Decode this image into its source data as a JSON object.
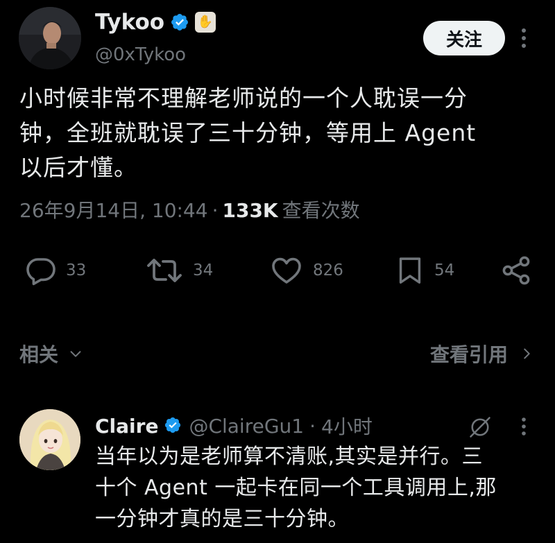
{
  "tweet": {
    "author": {
      "name": "Tykoo",
      "handle": "@0xTykoo",
      "affiliate_badge_glyph": "✋"
    },
    "follow_label": "关注",
    "text": "小时候非常不理解老师说的一个人耽误一分\n钟，全班就耽误了三十分钟，等用上 Agent\n以后才懂。",
    "timestamp": "26年9月14日, 10:44",
    "separator": "·",
    "views_count": "133K",
    "views_label": "查看次数",
    "stats": {
      "replies": "33",
      "retweets": "34",
      "likes": "826",
      "bookmarks": "54"
    }
  },
  "related": {
    "label": "相关",
    "quotes_label": "查看引用"
  },
  "reply": {
    "name": "Claire",
    "handle": "@ClaireGu1",
    "separator": "·",
    "time": "4小时",
    "text": "当年以为是老师算不清账,其实是并行。三\n十个 Agent 一起卡在同一个工具调用上,那\n一分钟才真的是三十分钟。"
  },
  "colors": {
    "background": "#000000",
    "text_primary": "#e7e9ea",
    "text_secondary": "#71767b",
    "verified_blue": "#1d9bf0",
    "follow_button_bg": "#eff3f4"
  },
  "icons": {
    "verified": "verified-badge-icon",
    "more": "more-vertical-icon",
    "reply": "reply-icon",
    "retweet": "retweet-icon",
    "like": "heart-icon",
    "bookmark": "bookmark-icon",
    "share": "share-icon",
    "chevron_down": "chevron-down-icon",
    "chevron_right": "chevron-right-icon",
    "grok": "grok-icon"
  }
}
